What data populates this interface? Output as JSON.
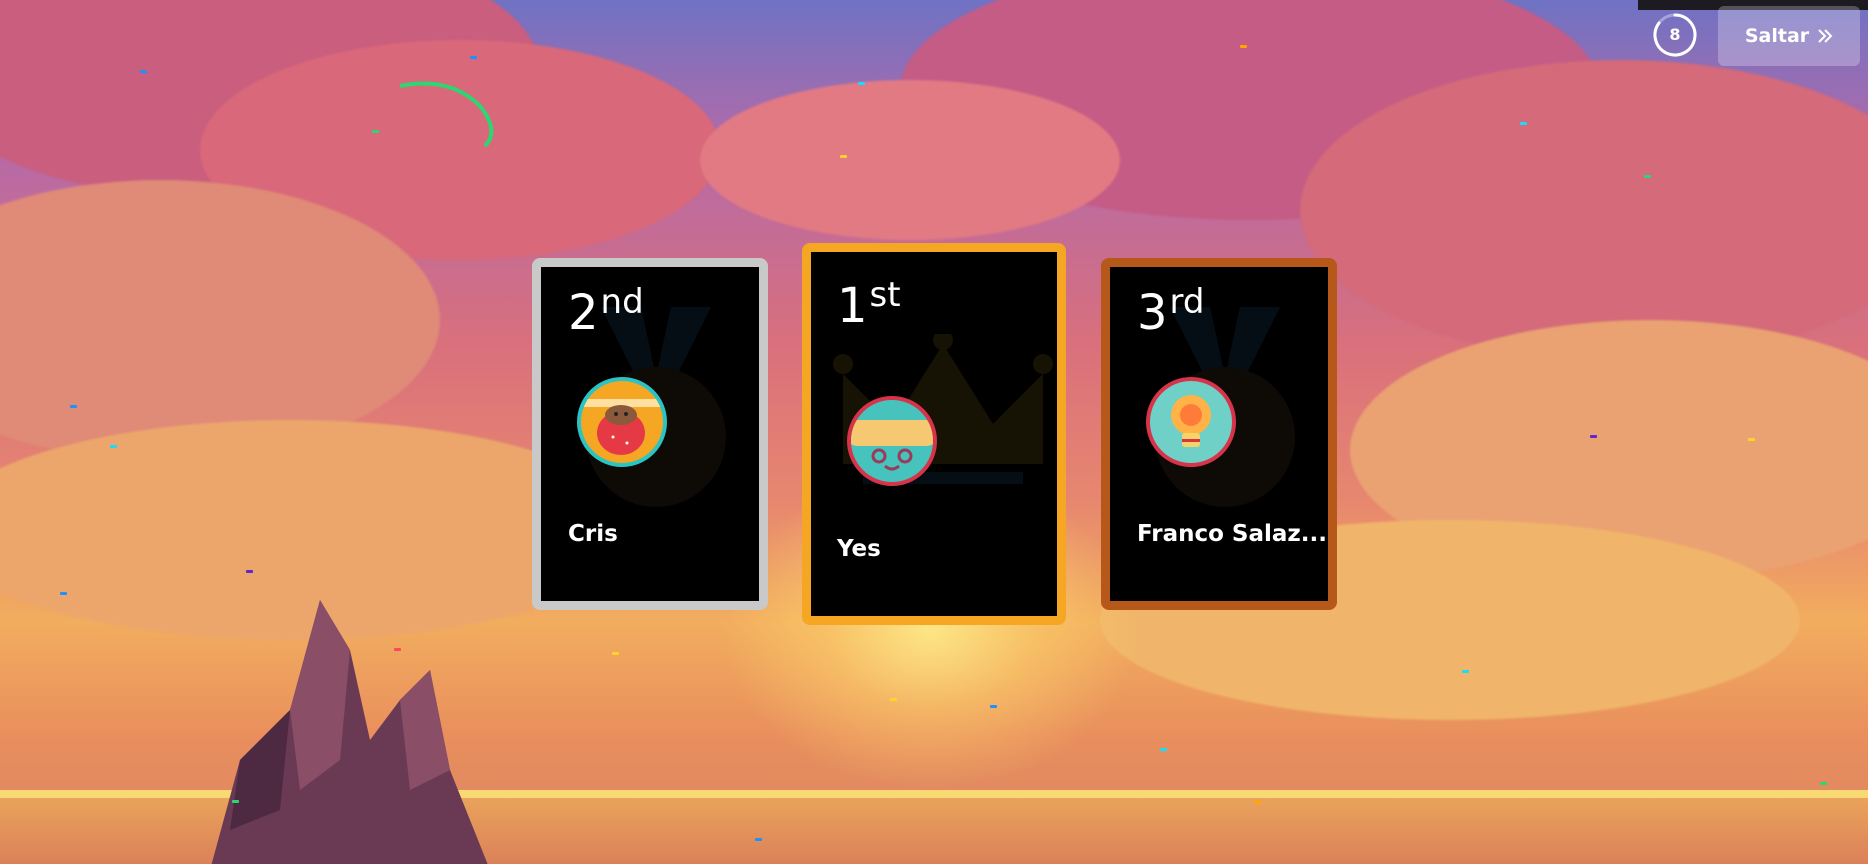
{
  "timer": {
    "value": "8"
  },
  "skip_button": {
    "label": "Saltar",
    "icon": "double-chevron-right-icon"
  },
  "podium": [
    {
      "place_number": "2",
      "place_suffix": "nd",
      "name": "Cris",
      "avatar": "sloth-strawberry-avatar",
      "border_color": "#c9c9c9",
      "bg_icon": "medal-icon"
    },
    {
      "place_number": "1",
      "place_suffix": "st",
      "name": "Yes",
      "avatar": "bandage-face-avatar",
      "border_color": "#f5a623",
      "bg_icon": "crown-icon"
    },
    {
      "place_number": "3",
      "place_suffix": "rd",
      "name": "Franco Salaz...",
      "avatar": "lightbulb-avatar",
      "border_color": "#b5581a",
      "bg_icon": "medal-icon"
    }
  ]
}
